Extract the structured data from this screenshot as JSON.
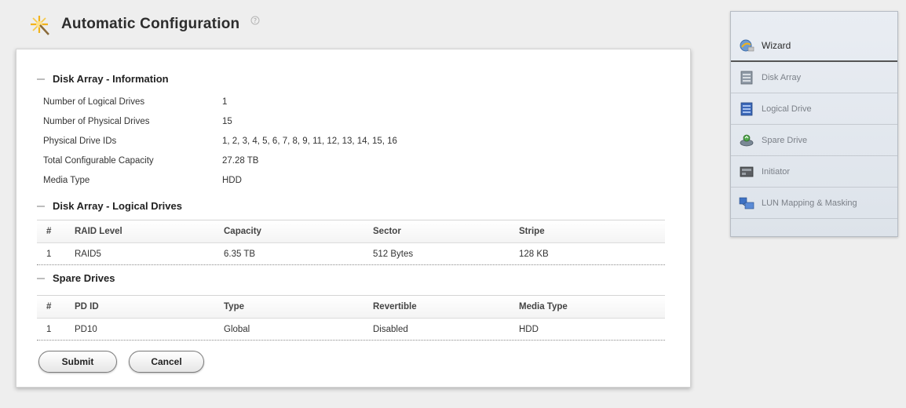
{
  "page": {
    "title": "Automatic Configuration",
    "title_icon": "star-icon",
    "help_icon": "help-icon"
  },
  "disk_array_info": {
    "title": "Disk Array - Information",
    "rows": [
      {
        "label": "Number of Logical Drives",
        "value": "1"
      },
      {
        "label": "Number of Physical Drives",
        "value": "15"
      },
      {
        "label": "Physical Drive IDs",
        "value": "1, 2, 3, 4, 5, 6, 7, 8, 9, 11, 12, 13, 14, 15, 16"
      },
      {
        "label": "Total Configurable Capacity",
        "value": "27.28 TB"
      },
      {
        "label": "Media Type",
        "value": "HDD"
      }
    ]
  },
  "logical_drives": {
    "title": "Disk Array - Logical Drives",
    "columns": [
      "#",
      "RAID Level",
      "Capacity",
      "Sector",
      "Stripe"
    ],
    "rows": [
      [
        "1",
        "RAID5",
        "6.35 TB",
        "512 Bytes",
        "128 KB"
      ]
    ]
  },
  "spare_drives": {
    "title": "Spare Drives",
    "columns": [
      "#",
      "PD ID",
      "Type",
      "Revertible",
      "Media Type"
    ],
    "rows": [
      [
        "1",
        "PD10",
        "Global",
        "Disabled",
        "HDD"
      ]
    ]
  },
  "buttons": {
    "submit": "Submit",
    "cancel": "Cancel"
  },
  "nav": {
    "items": [
      {
        "label": "Wizard",
        "icon": "wizard-icon",
        "active": true
      },
      {
        "label": "Disk Array",
        "icon": "disk-array-icon"
      },
      {
        "label": "Logical Drive",
        "icon": "logical-drive-icon"
      },
      {
        "label": "Spare Drive",
        "icon": "spare-drive-icon"
      },
      {
        "label": "Initiator",
        "icon": "initiator-icon"
      },
      {
        "label": "LUN Mapping & Masking",
        "icon": "lun-mapping-icon"
      }
    ]
  },
  "colors": {
    "background": "#eeeeee",
    "panel": "#ffffff",
    "nav_panel": "#e3e8ee",
    "star_accent": "#f2b31c"
  }
}
